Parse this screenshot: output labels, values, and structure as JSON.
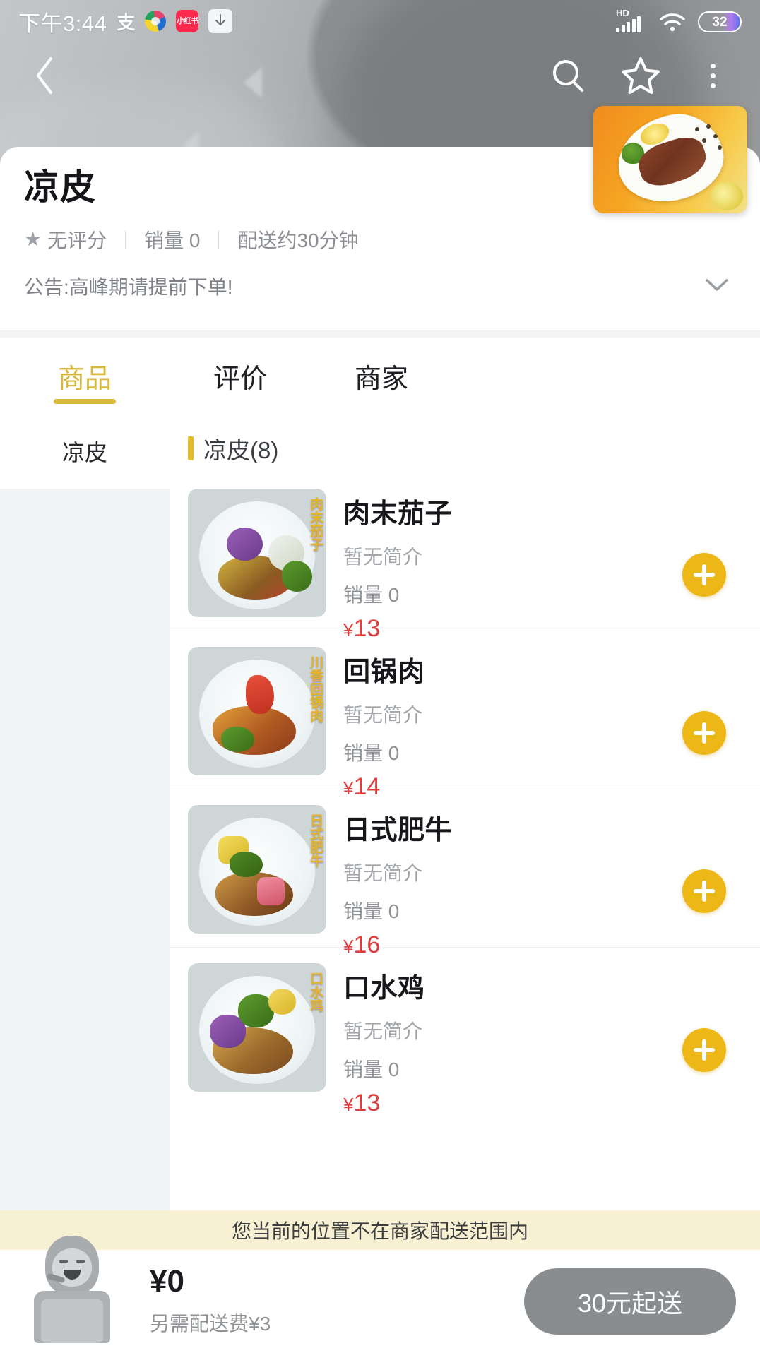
{
  "statusbar": {
    "time": "下午3:44",
    "icons": [
      {
        "name": "alipay-icon",
        "glyph": "支"
      },
      {
        "name": "colorball-icon",
        "glyph": ""
      },
      {
        "name": "xiaohongshu-icon",
        "glyph": "小红书"
      },
      {
        "name": "download-icon",
        "glyph": "↓"
      }
    ],
    "network_label": "HD",
    "battery_percent": "32"
  },
  "navbar": {
    "back": "back-chevron",
    "search": "search-icon",
    "favorite": "star-icon",
    "more": "more-dots-icon"
  },
  "shop": {
    "name": "凉皮",
    "rating": "无评分",
    "sales": "销量 0",
    "delivery_time": "配送约30分钟",
    "notice": "公告:高峰期请提前下单!",
    "expand_icon": "chevron-down-icon"
  },
  "tabs": [
    {
      "label": "商品",
      "active": true
    },
    {
      "label": "评价",
      "active": false
    },
    {
      "label": "商家",
      "active": false
    }
  ],
  "sidebar": {
    "items": [
      {
        "label": "凉皮",
        "active": true
      }
    ]
  },
  "menu": {
    "category_title": "凉皮(8)",
    "products": [
      {
        "name": "肉末茄子",
        "desc": "暂无简介",
        "sales": "销量 0",
        "price": "13",
        "currency": "¥",
        "image_label": "肉末茄子",
        "add_button": "add-to-cart"
      },
      {
        "name": "回锅肉",
        "desc": "暂无简介",
        "sales": "销量 0",
        "price": "14",
        "currency": "¥",
        "image_label": "川香回锅肉",
        "add_button": "add-to-cart"
      },
      {
        "name": "日式肥牛",
        "desc": "暂无简介",
        "sales": "销量 0",
        "price": "16",
        "currency": "¥",
        "image_label": "日式肥牛",
        "add_button": "add-to-cart"
      },
      {
        "name": "口水鸡",
        "desc": "暂无简介",
        "sales": "销量 0",
        "price": "13",
        "currency": "¥",
        "image_label": "口水鸡",
        "add_button": "add-to-cart"
      }
    ]
  },
  "bottom": {
    "warning": "您当前的位置不在商家配送范围内",
    "cart_total": "¥0",
    "delivery_fee": "另需配送费¥3",
    "order_button": "30元起送"
  },
  "colors": {
    "accent": "#d9b93c",
    "add_button": "#edb817",
    "price": "#e03c3c",
    "warning_bg": "#f8f0d2",
    "disabled_button": "#8a8d90"
  }
}
